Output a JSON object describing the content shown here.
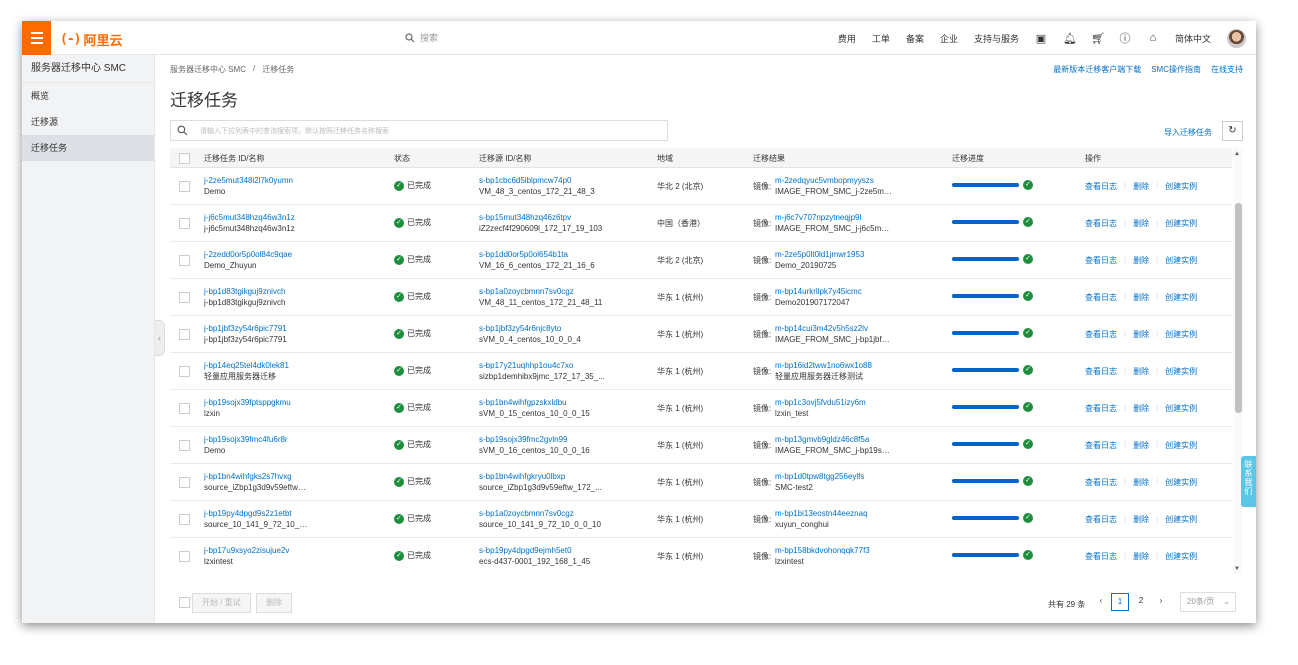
{
  "topbar": {
    "logo_text": "阿里云",
    "search_placeholder": "搜索",
    "nav": [
      "费用",
      "工单",
      "备案",
      "企业",
      "支持与服务"
    ],
    "lang": "简体中文"
  },
  "sidebar": {
    "title": "服务器迁移中心 SMC",
    "items": [
      "概览",
      "迁移源",
      "迁移任务"
    ],
    "active": 2
  },
  "breadcrumb": {
    "root": "服务器迁移中心 SMC",
    "sep": "/",
    "current": "迁移任务"
  },
  "top_links": [
    "最新版本迁移客户端下载",
    "SMC操作指南",
    "在线支持"
  ],
  "page_title": "迁移任务",
  "filter": {
    "placeholder": "请输入下拉列表中的查询搜索项，默认按照迁移任务名称搜索"
  },
  "import_label": "导入迁移任务",
  "table": {
    "headers": [
      "迁移任务 ID/名称",
      "状态",
      "迁移源 ID/名称",
      "地域",
      "迁移结果",
      "迁移进度",
      "操作"
    ],
    "result_prefix": "镜像:",
    "ops": [
      "查看日志",
      "删除",
      "创建实例"
    ],
    "rows": [
      {
        "id": "j-2ze5mut348i2l7k0yumn",
        "name": "Demo",
        "status": "已完成",
        "src_id": "s-bp1cbc6d5iblpmcw74p0",
        "src_name": "VM_48_3_centos_172_21_48_3",
        "region": "华北 2 (北京)",
        "img_id": "m-2zedqyuc5vmbopmyyszs",
        "img_name": "IMAGE_FROM_SMC_j-2ze5mut3...",
        "progress": 1.0
      },
      {
        "id": "j-j6c5mut348hzq46w3n1z",
        "name": "j-j6c5mut348hzq46w3n1z",
        "status": "已完成",
        "src_id": "s-bp15mut348hzq46z6tpv",
        "src_name": "iZ2zecf4f290609l_172_17_19_103",
        "region": "中国（香港）",
        "img_id": "m-j6c7v707npzytneqjp9l",
        "img_name": "IMAGE_FROM_SMC_j-j6c5mut3...",
        "progress": 1.0
      },
      {
        "id": "j-2zedd0or5p0ol84c9qae",
        "name": "Demo_Zhuyun",
        "status": "已完成",
        "src_id": "s-bp1dd0or5p0ol654b1ta",
        "src_name": "VM_16_6_centos_172_21_16_6",
        "region": "华北 2 (北京)",
        "img_id": "m-2ze5p0lt0ld1jmwr1953",
        "img_name": "Demo_20190725",
        "progress": 1.0
      },
      {
        "id": "j-bp1d83tgikguj9znivch",
        "name": "j-bp1d83tgikguj9znivch",
        "status": "已完成",
        "src_id": "s-bp1a0zoycbmnn7sv0cgz",
        "src_name": "VM_48_11_centos_172_21_48_11",
        "region": "华东 1 (杭州)",
        "img_id": "m-bp14urkrllpk7y45icmc",
        "img_name": "Demo201907172047",
        "progress": 1.0
      },
      {
        "id": "j-bp1jbf3zy54r6pic7791",
        "name": "j-bp1jbf3zy54r6pic7791",
        "status": "已完成",
        "src_id": "s-bp1jbf3zy54r6njc8yto",
        "src_name": "sVM_0_4_centos_10_0_0_4",
        "region": "华东 1 (杭州)",
        "img_id": "m-bp14cui3m42v5h5sz2lv",
        "img_name": "IMAGE_FROM_SMC_j-bp1jbf3zy...",
        "progress": 1.0
      },
      {
        "id": "j-bp14eq25tel4dk0lek81",
        "name": "轻量应用服务器迁移",
        "status": "已完成",
        "src_id": "s-bp17y21uqhhp1ou4c7xo",
        "src_name": "sizbp1demhibx9jmc_172_17_35_...",
        "region": "华东 1 (杭州)",
        "img_id": "m-bp16id2tww1no6wx1o88",
        "img_name": "轻量应用服务器迁移测试",
        "progress": 1.0
      },
      {
        "id": "j-bp19sojx39fptsppgkmu",
        "name": "lzxin",
        "status": "已完成",
        "src_id": "s-bp1bn4wihfgpzskxldbu",
        "src_name": "sVM_0_15_centos_10_0_0_15",
        "region": "华东 1 (杭州)",
        "img_id": "m-bp1c3ovj5fvdu51izy6m",
        "img_name": "lzxin_test",
        "progress": 1.0
      },
      {
        "id": "j-bp19sojx39fmc4fu6r8r",
        "name": "Demo",
        "status": "已完成",
        "src_id": "s-bp19sojx39fmc2gvln99",
        "src_name": "sVM_0_16_centos_10_0_0_16",
        "region": "华东 1 (杭州)",
        "img_id": "m-bp13gmvb9gldz46c8f5a",
        "img_name": "IMAGE_FROM_SMC_j-bp19sojx...",
        "progress": 1.0
      },
      {
        "id": "j-bp1bn4wihfgks2s7hvxg",
        "name": "source_iZbp1g3d9v59eftw_1...",
        "status": "已完成",
        "src_id": "s-bp1bn4wihfgkryu0lbxp",
        "src_name": "source_iZbp1g3d9v59eftw_172_...",
        "region": "华东 1 (杭州)",
        "img_id": "m-bp1d0tpw8tgg256eylfs",
        "img_name": "SMC-test2",
        "progress": 1.0
      },
      {
        "id": "j-bp19py4dpgd9s2z1etbt",
        "name": "source_10_141_9_72_10_0_0...",
        "status": "已完成",
        "src_id": "s-bp1a0zoycbmnn7sv0cgz",
        "src_name": "source_10_141_9_72_10_0_0_10",
        "region": "华东 1 (杭州)",
        "img_id": "m-bp1bi13eostn44eeznaq",
        "img_name": "xuyun_conghui",
        "progress": 1.0
      },
      {
        "id": "j-bp17u9xsyo2zisujue2v",
        "name": "lzxintest",
        "status": "已完成",
        "src_id": "s-bp19py4dpgd9ejmh5et0",
        "src_name": "ecs-d437-0001_192_168_1_45",
        "region": "华东 1 (杭州)",
        "img_id": "m-bp158bkdvohonqqk77f3",
        "img_name": "lzxintest",
        "progress": 1.0
      }
    ]
  },
  "footer": {
    "start_retry": "开始 / 重试",
    "delete": "删除",
    "total": "共有 29 条",
    "pages": [
      "1",
      "2"
    ],
    "current_page": "1",
    "page_size": "20条/页"
  },
  "contact": [
    "联",
    "系",
    "我",
    "们"
  ],
  "colors": {
    "brand": "#ff6a00",
    "link": "#0070cc",
    "progress": "#0064c8",
    "success": "#1e8e3e"
  }
}
